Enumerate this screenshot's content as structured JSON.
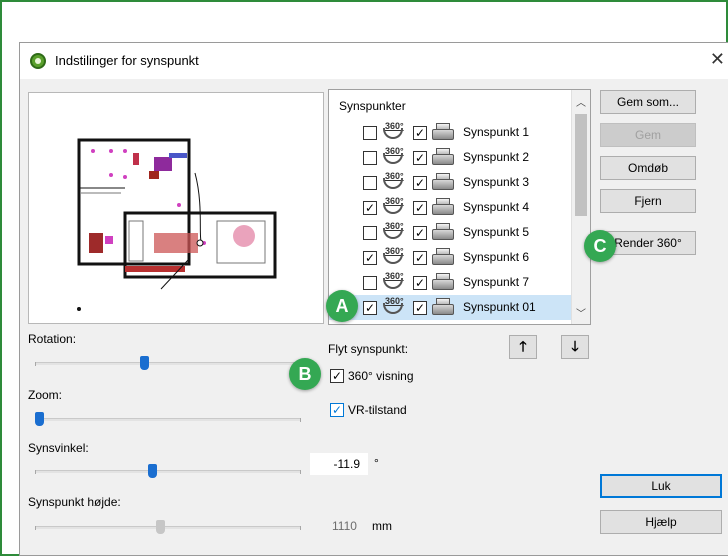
{
  "window": {
    "title": "Indstilinger for synspunkt",
    "close": "✕"
  },
  "colors": {
    "frame": "#2e8b3a",
    "badge": "#34a853",
    "selection": "#cce4f7",
    "accent": "#0078d7"
  },
  "sliders": {
    "rotation": {
      "label": "Rotation:",
      "fraction": 0.41
    },
    "zoom": {
      "label": "Zoom:",
      "fraction": 0.0
    },
    "synsvinkel": {
      "label": "Synsvinkel:",
      "fraction": 0.44,
      "value": "-11.9",
      "unit": "°"
    },
    "hojde": {
      "label": "Synspunkt højde:",
      "fraction": 0.47,
      "value": "1110",
      "unit": "mm"
    }
  },
  "list": {
    "header": "Synspunkter",
    "rows": [
      {
        "label": "Synspunkt 1",
        "check360": "",
        "checkCam": "✓"
      },
      {
        "label": "Synspunkt 2",
        "check360": "",
        "checkCam": "✓"
      },
      {
        "label": "Synspunkt 3",
        "check360": "",
        "checkCam": "✓"
      },
      {
        "label": "Synspunkt 4",
        "check360": "✓",
        "checkCam": "✓"
      },
      {
        "label": "Synspunkt 5",
        "check360": "",
        "checkCam": "✓"
      },
      {
        "label": "Synspunkt 6",
        "check360": "✓",
        "checkCam": "✓"
      },
      {
        "label": "Synspunkt 7",
        "check360": "",
        "checkCam": "✓"
      },
      {
        "label": "Synspunkt 01",
        "check360": "✓",
        "checkCam": "✓",
        "selected": true
      }
    ],
    "icon360_text": "360°"
  },
  "move": {
    "label": "Flyt synspunkt:",
    "up": "🡑",
    "down": "🡓"
  },
  "options": {
    "view360": {
      "label": "360° visning",
      "mark": "✓"
    },
    "vr": {
      "label": "VR-tilstand",
      "mark": "✓"
    }
  },
  "buttons": {
    "gem_som": "Gem som...",
    "gem": "Gem",
    "omdob": "Omdøb",
    "fjern": "Fjern",
    "render360": "Render 360°",
    "luk": "Luk",
    "hjaelp": "Hjælp"
  },
  "badges": {
    "a": "A",
    "b": "B",
    "c": "C"
  }
}
